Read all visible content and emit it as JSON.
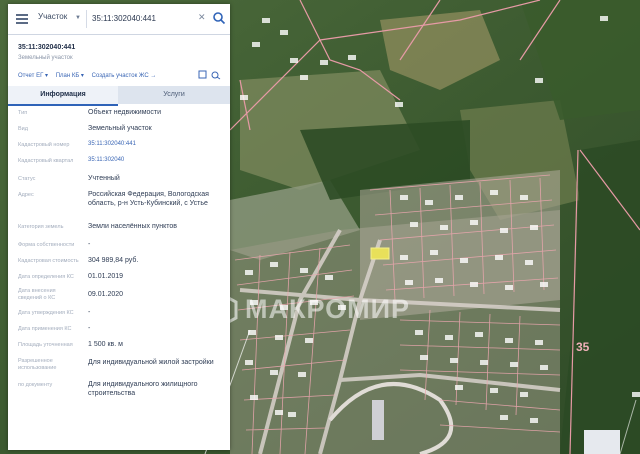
{
  "search": {
    "type_label": "Участок",
    "query": "35:11:302040:441"
  },
  "object": {
    "number": "35:11:302040:441",
    "subtitle": "Земельный участок"
  },
  "links": {
    "item1": "Отчет ЕГ ▾",
    "item2": "План КБ ▾",
    "item3": "Создать участок ЖС →"
  },
  "tabs": {
    "info": "Информация",
    "services": "Услуги"
  },
  "details": [
    {
      "label": "Тип",
      "value": "Объект недвижимости",
      "link": false
    },
    {
      "label": "Вид",
      "value": "Земельный участок",
      "link": false
    },
    {
      "label": "Кадастровый номер",
      "value": "35:11:302040:441",
      "link": true
    },
    {
      "label": "Кадастровый квартал",
      "value": "35:11:302040",
      "link": true
    },
    {
      "label": "Статус",
      "value": "Учтенный",
      "link": false
    },
    {
      "label": "Адрес",
      "value": "Российская Федерация, Вологодская область, р-н Усть-Кубинский, с Устье",
      "link": false
    },
    {
      "label": "Категория земель",
      "value": "Земли населённых пунктов",
      "link": false
    },
    {
      "label": "Форма собственности",
      "value": "-",
      "link": false
    },
    {
      "label": "Кадастровая стоимость",
      "value": "304 989,84 руб.",
      "link": false
    },
    {
      "label": "Дата определения КС",
      "value": "01.01.2019",
      "link": false
    },
    {
      "label": "Дата внесения сведений о КС",
      "value": "09.01.2020",
      "link": false
    },
    {
      "label": "Дата утверждения КС",
      "value": "-",
      "link": false
    },
    {
      "label": "Дата применения КС",
      "value": "-",
      "link": false
    },
    {
      "label": "Площадь уточненная",
      "value": "1 500 кв. м",
      "link": false
    },
    {
      "label": "Разрешенное использование",
      "value": "Для индивидуальной жилой застройки",
      "link": false
    },
    {
      "label": "по документу",
      "value": "Для индивидуального жилищного строительства",
      "link": false
    }
  ],
  "map": {
    "area_label": "35",
    "watermark": "МАКРОМИР"
  },
  "colors": {
    "parcel_outline": "#e8a0a8",
    "road": "#d9d2cc",
    "accent_link": "#3a66b5",
    "highlight_parcel": "#e8e05a"
  }
}
